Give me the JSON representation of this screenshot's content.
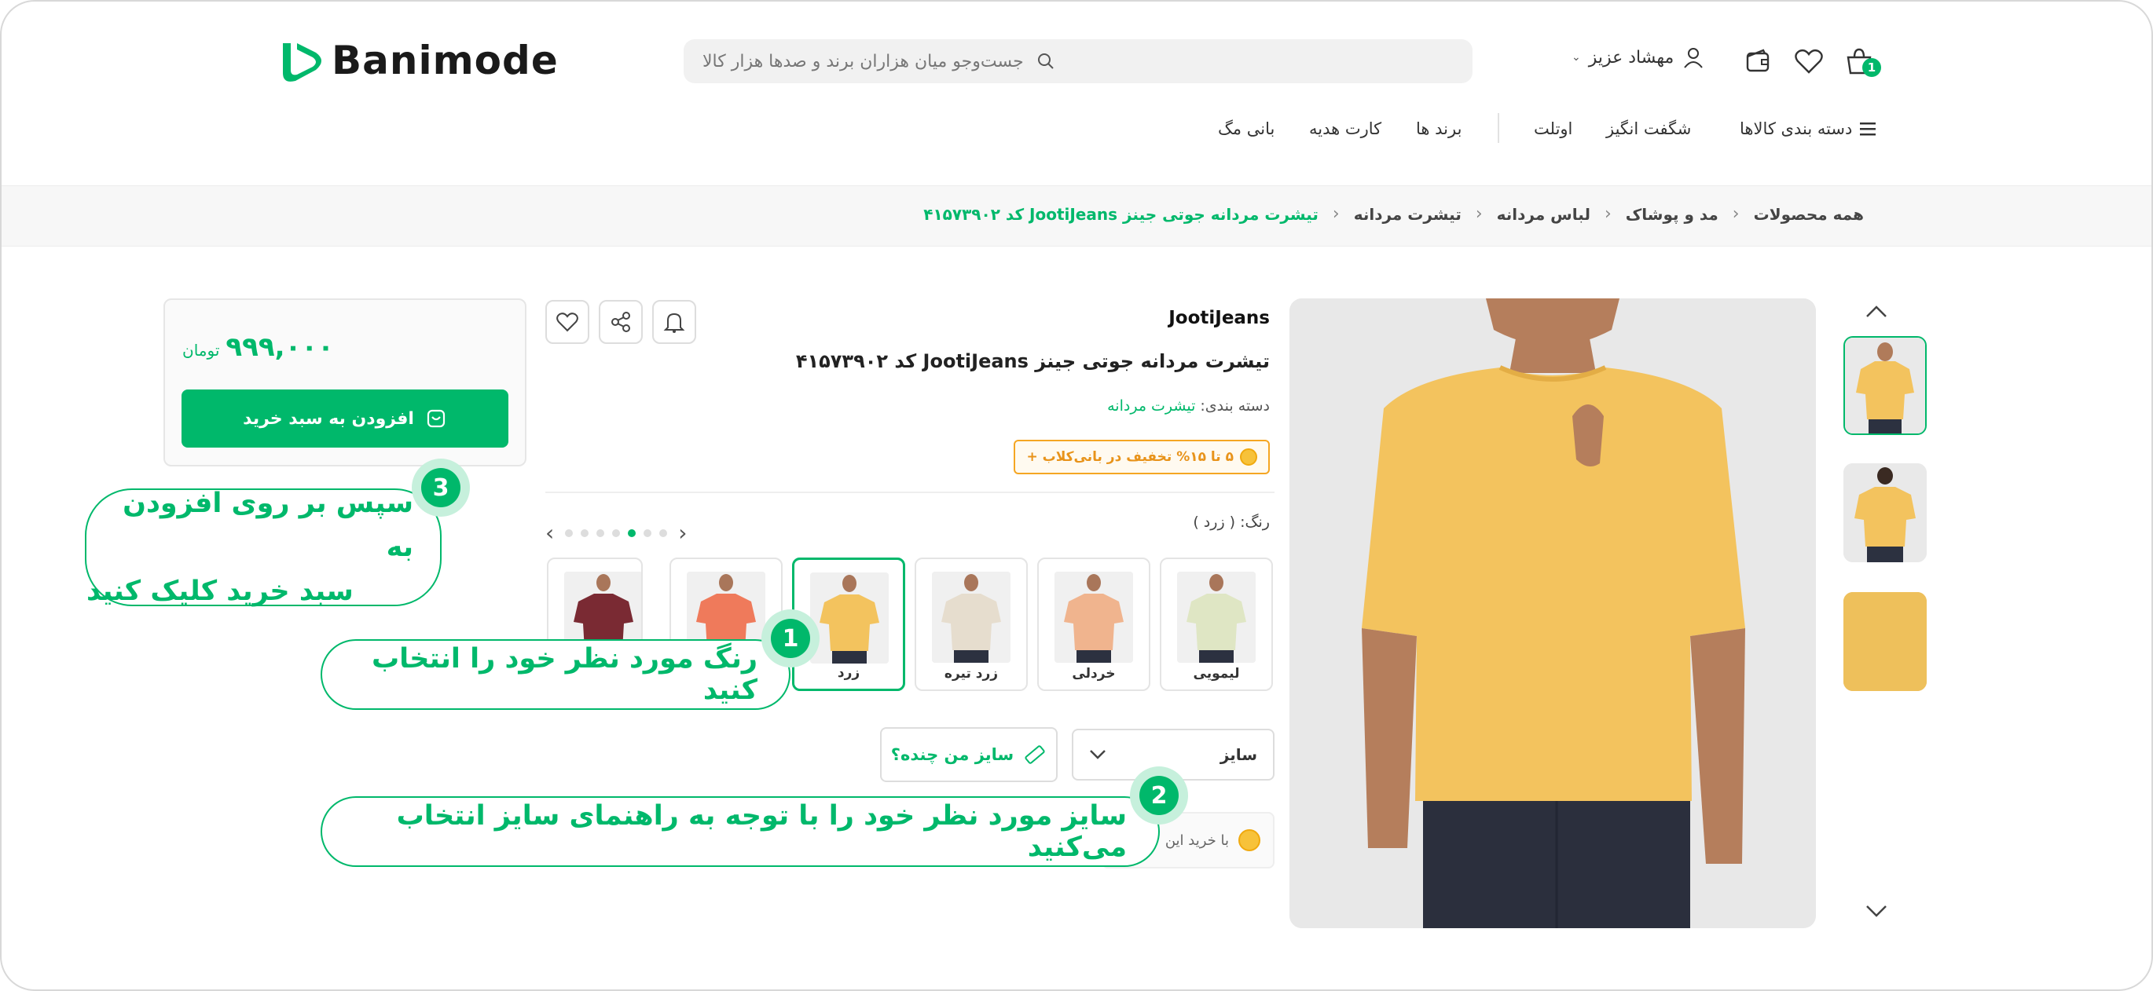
{
  "header": {
    "logo_text": "Banimode",
    "search_placeholder": "جست‌وجو میان هزاران برند و صدها هزار کالا",
    "user_name": "مهشاد عزیز",
    "cart_count": "1"
  },
  "nav": {
    "categories": "دسته بندی کالاها",
    "items": [
      "شگفت انگیز",
      "اوتلت",
      "برند ها",
      "کارت هدیه",
      "بانی مگ"
    ]
  },
  "breadcrumb": [
    "همه محصولات",
    "مد و پوشاک",
    "لباس مردانه",
    "تیشرت مردانه",
    "تیشرت مردانه جوتی جینز JootiJeans کد ۴۱۵۷۳۹۰۲"
  ],
  "product": {
    "brand": "JootiJeans",
    "title": "تیشرت مردانه جوتی جینز JootiJeans کد ۴۱۵۷۳۹۰۲",
    "category_label": "دسته بندی:",
    "category_value": "تیشرت مردانه",
    "promo": "۵ تا ۱۵% تخفیف در بانی‌کلاب +",
    "color_label": "رنگ: ( زرد )",
    "colors": [
      {
        "name": "لیمویی",
        "hex": "#dfe6c4"
      },
      {
        "name": "خردلی",
        "hex": "#f0b48e"
      },
      {
        "name": "زرد تیره",
        "hex": "#e6ddce"
      },
      {
        "name": "زرد",
        "hex": "#f3c35e"
      },
      {
        "name": "",
        "hex": "#ef7a5b"
      },
      {
        "name": "",
        "hex": "#7a2a33"
      }
    ],
    "selected_color": "زرد",
    "size_select": "سایز",
    "size_guide": "سایز من چنده؟",
    "note_text": "با خرید این",
    "shirt_color": "#f3c35e"
  },
  "buy": {
    "price": "۹۹۹,۰۰۰",
    "currency": "تومان",
    "add_to_cart": "افزودن به سبد خرید"
  },
  "callouts": {
    "one": {
      "num": "1",
      "text": "رنگ مورد نظر خود را انتخاب کنید"
    },
    "two": {
      "num": "2",
      "text": "سایز مورد نظر خود را با توجه به راهنمای سایز انتخاب می‌کنید"
    },
    "three": {
      "num": "3",
      "line1": "سپس بر روی افزودن به",
      "line2": "سبد خرید کلیک کنید"
    }
  },
  "colors": {
    "accent": "#00b86b",
    "promo": "#f5a623"
  }
}
